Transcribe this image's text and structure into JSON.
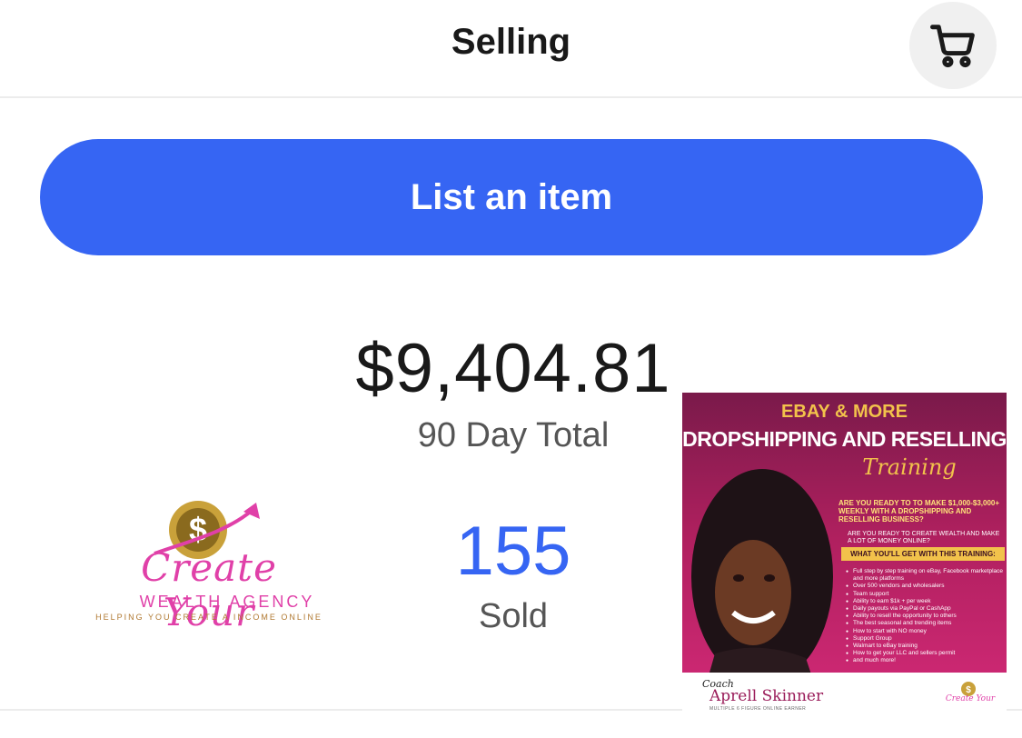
{
  "header": {
    "title": "Selling",
    "cart_icon": "shopping-cart-icon"
  },
  "actions": {
    "list_item_label": "List an item",
    "accent_color": "#3665f3"
  },
  "stats": {
    "total_amount": "$9,404.81",
    "total_label": "90 Day Total",
    "sold_count": "155",
    "sold_label": "Sold"
  },
  "logo": {
    "script": "Create Your",
    "name": "WEALTH AGENCY",
    "tagline": "HELPING YOU CREATE A INCOME ONLINE",
    "icon": "dollar-coin-icon"
  },
  "flyer": {
    "line1": "EBAY & MORE",
    "line2": "DROPSHIPPING AND RESELLING",
    "line3": "Training",
    "question": "ARE YOU READY TO TO MAKE $1,000-$3,000+ WEEKLY WITH A DROPSHIPPING AND RESELLING BUSINESS?",
    "question2": "ARE YOU READY TO CREATE WEALTH AND MAKE A LOT OF MONEY ONLINE?",
    "banner": "WHAT YOU'LL GET WITH THIS TRAINING:",
    "items": [
      "Full step by step training on eBay, Facebook marketplace and more platforms",
      "Over 500 vendors and wholesalers",
      "Team support",
      "Ability to earn $1k + per week",
      "Daily payouts via PayPal or CashApp",
      "Ability to resell the opportunity to others",
      "The best seasonal and trending items",
      "How to start with NO money",
      "Support Group",
      "Walmart to eBay training",
      "How to get your LLC and sellers permit",
      "and much more!"
    ],
    "coach_label": "Coach",
    "coach_name": "Aprell Skinner",
    "coach_sub": "MULTIPLE 6 FIGURE ONLINE EARNER",
    "mini_logo": "Create Your"
  }
}
